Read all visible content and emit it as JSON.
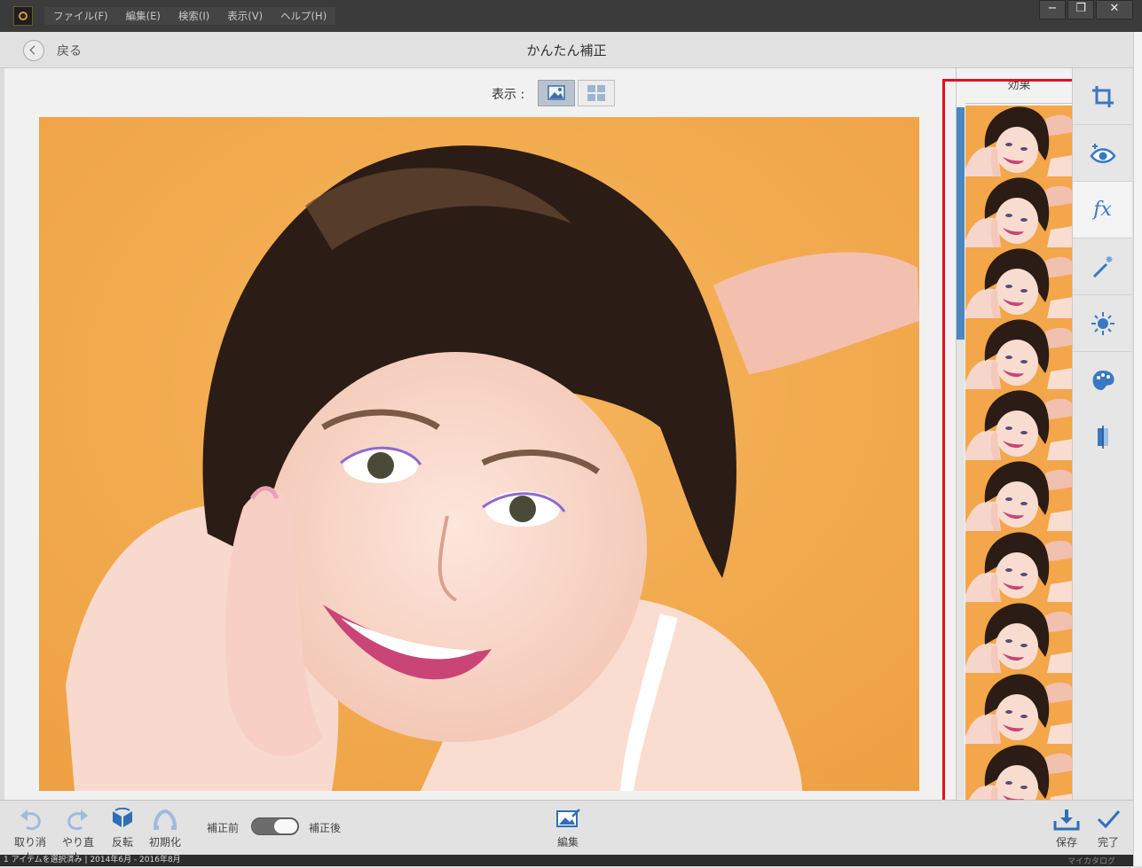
{
  "menu": {
    "items": [
      "ファイル(F)",
      "編集(E)",
      "検索(I)",
      "表示(V)",
      "ヘルプ(H)"
    ]
  },
  "window_controls": {
    "minimize": "−",
    "restore": "❐",
    "close": "✕"
  },
  "header": {
    "back_label": "戻る",
    "title": "かんたん補正"
  },
  "view": {
    "label": "表示 :"
  },
  "effects_panel": {
    "title": "効果",
    "thumbnail_count": 10
  },
  "tools": [
    "crop-icon",
    "eye-icon",
    "fx-icon",
    "magic-wand-icon",
    "brightness-icon",
    "palette-icon",
    "straighten-icon"
  ],
  "tool_fx_text": "fx",
  "bottom": {
    "undo": "取り消し",
    "redo": "やり直し",
    "flip": "反転",
    "reset": "初期化",
    "before": "補正前",
    "after": "補正後",
    "edit": "編集",
    "save": "保存",
    "done": "完了"
  },
  "status": {
    "text": "1 アイテムを選択済み  |  2014年6月 - 2016年8月",
    "catalog": "マイカタログ"
  },
  "colors": {
    "accent": "#4a86c0",
    "highlight_box": "#e2101e",
    "photo_background": "#f0a94a"
  }
}
